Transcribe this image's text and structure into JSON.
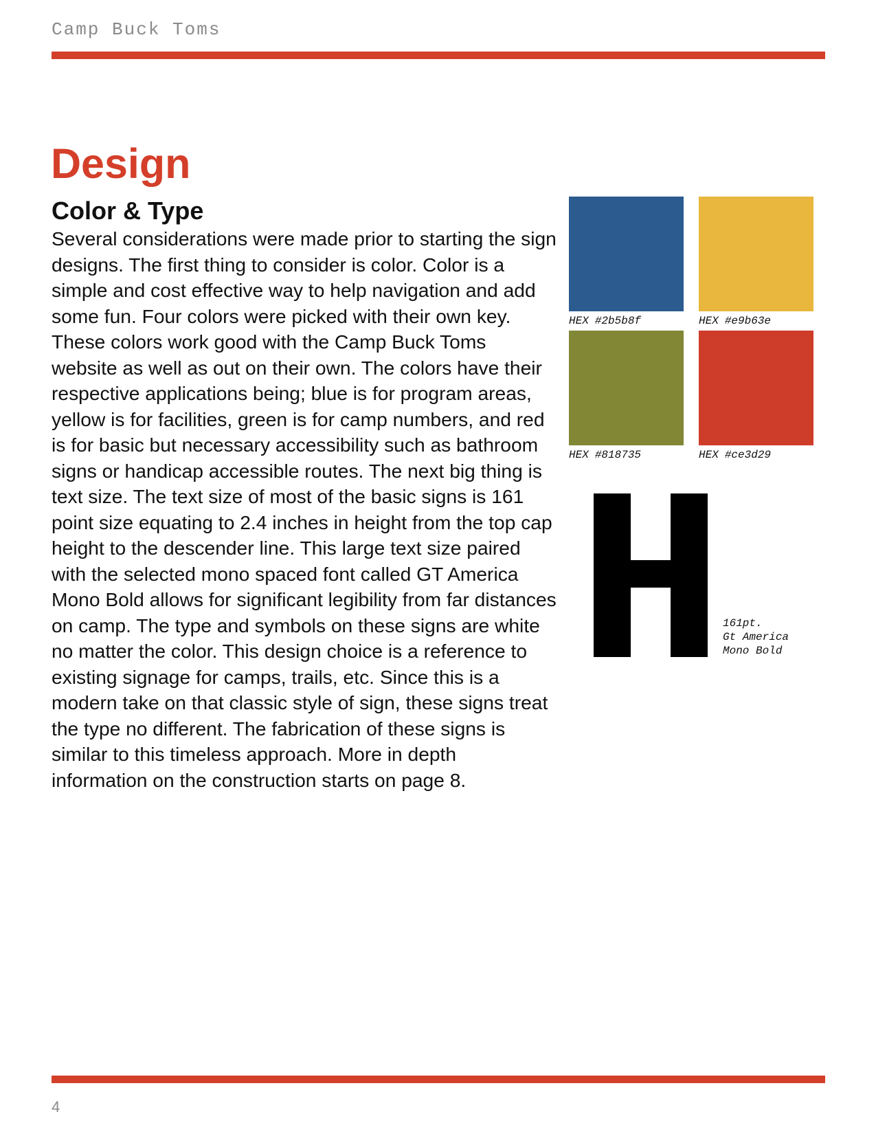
{
  "header": {
    "running_head": "Camp Buck Toms"
  },
  "colors": {
    "accent": "#d43f2a",
    "rule": "#d43f2a",
    "muted_text": "#8a8a8a"
  },
  "page": {
    "title": "Design",
    "section_title": "Color & Type",
    "body": "Several considerations were made prior to starting the sign designs. The first thing to consider is color. Color is a simple and cost effective way to help navigation and add some fun. Four colors were picked with their own key. These colors work good with the Camp Buck Toms website as well as out on their own. The colors have their respective applications being; blue is for program areas, yellow is for facilities, green is for camp numbers, and red is for basic but necessary accessibility such as bathroom signs or handicap accessible routes. The next big thing is text size. The text size of most of the basic signs is 161 point size equating to 2.4 inches in height from the top cap height to the descender line. This large text size paired with the selected mono spaced font called GT America Mono Bold allows for significant legibility from far distances on camp. The type and symbols on these signs are white no matter the color. This design choice is a reference to existing signage for camps, trails, etc. Since this is a modern take on that classic style of sign, these signs treat the type no different. The fabrication of these signs is similar to this timeless approach. More in depth information on the construction starts on page 8."
  },
  "swatches": [
    {
      "label": "HEX",
      "value": "#2b5b8f"
    },
    {
      "label": "HEX",
      "value": "#e9b63e"
    },
    {
      "label": "HEX",
      "value": "#818735"
    },
    {
      "label": "HEX",
      "value": "#ce3d29"
    }
  ],
  "type_specimen": {
    "glyph": "H",
    "caption": [
      "161pt.",
      "Gt America",
      "Mono Bold"
    ]
  },
  "footer": {
    "page_number": "4"
  }
}
